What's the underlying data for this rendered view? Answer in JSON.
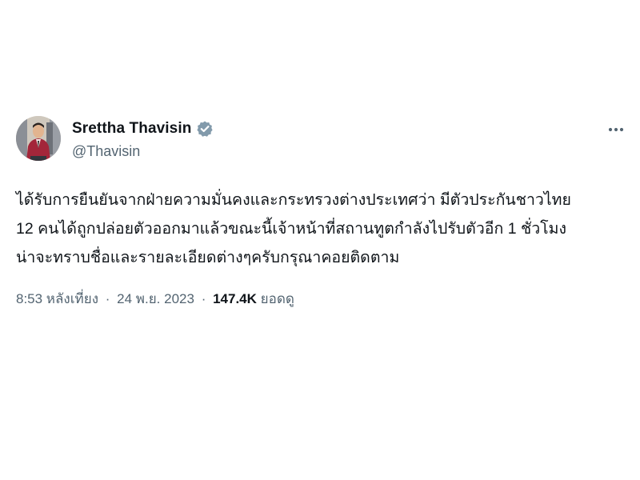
{
  "tweet": {
    "author": {
      "display_name": "Srettha Thavisin",
      "handle": "@Thavisin",
      "verified_icon": "verified-badge-icon",
      "avatar": "profile-photo"
    },
    "more_icon": "more-horizontal-icon",
    "text_lines": [
      "ได้รับการยืนยันจากฝ่ายความมั่นคงและกระทรวงต่างประเทศว่า มีตัวประกันชาวไทย",
      "12 คนได้ถูกปล่อยตัวออกมาแล้วขณะนี้เจ้าหน้าที่สถานทูตกำลังไปรับตัวอีก 1 ชั่วโมง",
      "น่าจะทราบชื่อและรายละเอียดต่างๆครับกรุณาคอยติดตาม"
    ],
    "meta": {
      "time": "8:53 หลังเที่ยง",
      "separator": "·",
      "date": "24 พ.ย. 2023",
      "views_count": "147.4K",
      "views_label": "ยอดดู"
    }
  },
  "colors": {
    "text_primary": "#0f1419",
    "text_secondary": "#536471",
    "verified_badge": "#829aab",
    "background": "#ffffff"
  }
}
